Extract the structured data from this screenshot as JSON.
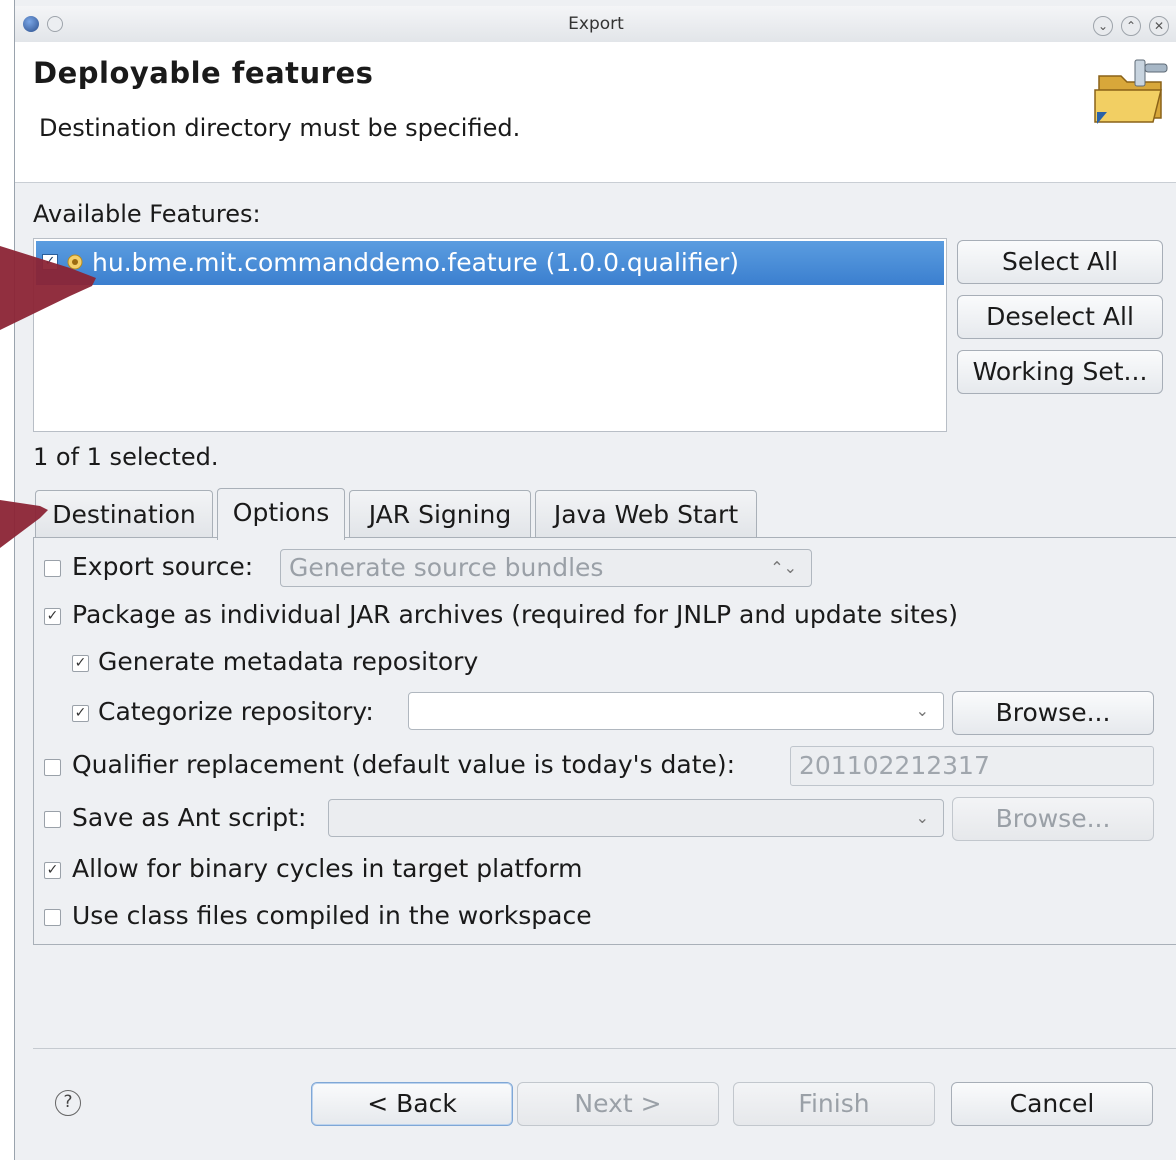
{
  "window": {
    "title": "Export"
  },
  "header": {
    "title": "Deployable features",
    "message": "Destination directory must be specified."
  },
  "features": {
    "label": "Available Features:",
    "items": [
      {
        "label": "hu.bme.mit.commanddemo.feature (1.0.0.qualifier)",
        "checked": true
      }
    ],
    "status": "1 of 1 selected.",
    "buttons": {
      "select_all": "Select All",
      "deselect_all": "Deselect All",
      "working_set": "Working Set..."
    }
  },
  "tabs": [
    {
      "label": "Destination"
    },
    {
      "label": "Options",
      "active": true
    },
    {
      "label": "JAR Signing"
    },
    {
      "label": "Java Web Start"
    }
  ],
  "options": {
    "export_source": {
      "label": "Export source:",
      "checked": false,
      "combo_value": "Generate source bundles"
    },
    "package_jar": {
      "label": "Package as individual JAR archives (required for JNLP and update sites)",
      "checked": true
    },
    "generate_metadata": {
      "label": "Generate metadata repository",
      "checked": true
    },
    "categorize": {
      "label": "Categorize repository:",
      "checked": true,
      "combo_value": "",
      "browse": "Browse..."
    },
    "qualifier": {
      "label": "Qualifier replacement (default value is today's date):",
      "checked": false,
      "value": "201102212317"
    },
    "ant_script": {
      "label": "Save as Ant script:",
      "checked": false,
      "combo_value": "",
      "browse": "Browse..."
    },
    "binary_cycles": {
      "label": "Allow for binary cycles in target platform",
      "checked": true
    },
    "class_files": {
      "label": "Use class files compiled in the workspace",
      "checked": false
    }
  },
  "footer": {
    "back": "< Back",
    "next": "Next >",
    "finish": "Finish",
    "cancel": "Cancel"
  },
  "icons": {
    "help": "?",
    "check": "✓",
    "combo_arrow_updown": "⌃⌄",
    "combo_arrow_down": "⌄",
    "title_minimize": "⌄",
    "title_maximize": "⌃",
    "title_close": "✕"
  },
  "colors": {
    "annotation_arrow": "#8b2435",
    "selection": "#4a8fd9"
  }
}
